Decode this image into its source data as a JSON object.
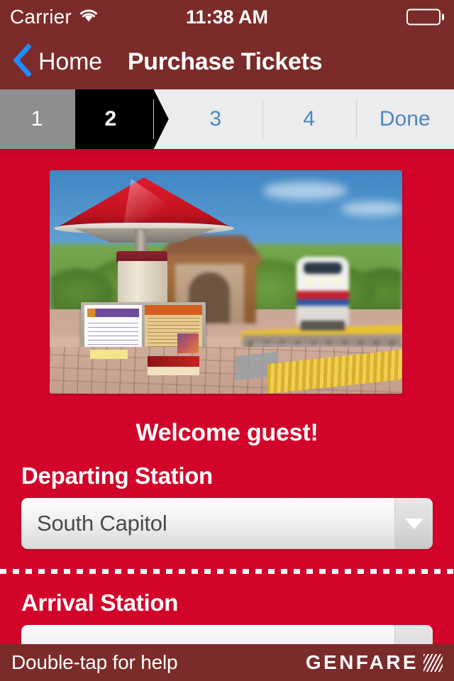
{
  "status_bar": {
    "carrier": "Carrier",
    "wifi_icon": "wifi-icon",
    "time": "11:38 AM",
    "battery_icon": "battery-empty-icon"
  },
  "nav_bar": {
    "back_icon": "chevron-left-icon",
    "back_label": "Home",
    "title": "Purchase Tickets"
  },
  "step_bar": {
    "steps": [
      {
        "label": "1",
        "state": "completed"
      },
      {
        "label": "2",
        "state": "current"
      },
      {
        "label": "3",
        "state": "upcoming"
      },
      {
        "label": "4",
        "state": "upcoming"
      },
      {
        "label": "Done",
        "state": "upcoming"
      }
    ]
  },
  "main": {
    "hero_image_alt": "train-station-platform-photo",
    "welcome_text": "Welcome guest!",
    "departing": {
      "label": "Departing Station",
      "value": "South Capitol",
      "caret_icon": "caret-down-icon"
    },
    "arrival": {
      "label": "Arrival Station",
      "value": "",
      "caret_icon": "caret-down-icon"
    }
  },
  "footer": {
    "help_text": "Double-tap for help",
    "brand_name": "GENFARE",
    "brand_mark_icon": "genfare-hatch-mark-icon"
  },
  "colors": {
    "chrome": "#7B2B29",
    "background_red": "#D2042A",
    "accent_blue": "#1E8CFF",
    "step_blue": "#4A87C4",
    "step_completed_gray": "#8E8E8E",
    "step_current_black": "#000000",
    "step_track": "#ECECEC"
  }
}
